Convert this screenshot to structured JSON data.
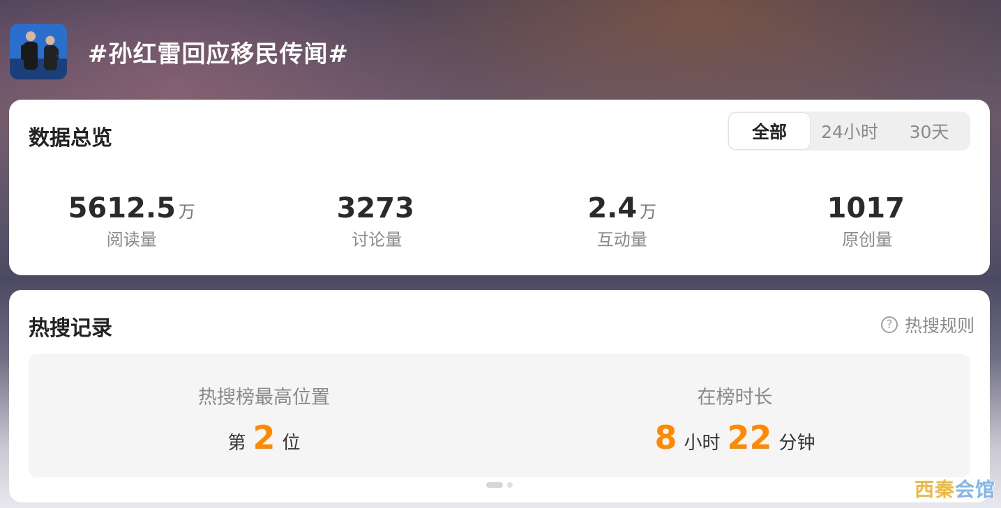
{
  "header": {
    "avatar_icon": "topic-photo",
    "title": "#孙红雷回应移民传闻#"
  },
  "overview": {
    "title": "数据总览",
    "tabs": [
      {
        "label": "全部",
        "active": true
      },
      {
        "label": "24小时",
        "active": false
      },
      {
        "label": "30天",
        "active": false
      }
    ],
    "stats": [
      {
        "value": "5612.5",
        "unit": "万",
        "label": "阅读量"
      },
      {
        "value": "3273",
        "unit": "",
        "label": "讨论量"
      },
      {
        "value": "2.4",
        "unit": "万",
        "label": "互动量"
      },
      {
        "value": "1017",
        "unit": "",
        "label": "原创量"
      }
    ]
  },
  "hot": {
    "title": "热搜记录",
    "rules_label": "热搜规则",
    "rules_icon": "question-circle-icon",
    "peak": {
      "label": "热搜榜最高位置",
      "prefix": "第",
      "rank": "2",
      "suffix": "位"
    },
    "duration": {
      "label": "在榜时长",
      "hours": "8",
      "hours_unit": "小时",
      "minutes": "22",
      "minutes_unit": "分钟"
    },
    "pagination": {
      "pages": 2,
      "current": 1
    }
  },
  "watermark": {
    "part1": "西秦",
    "part2": "会馆"
  },
  "colors": {
    "accent_orange": "#ff8a00",
    "card_bg": "#ffffff",
    "panel_bg": "#f5f5f5"
  }
}
